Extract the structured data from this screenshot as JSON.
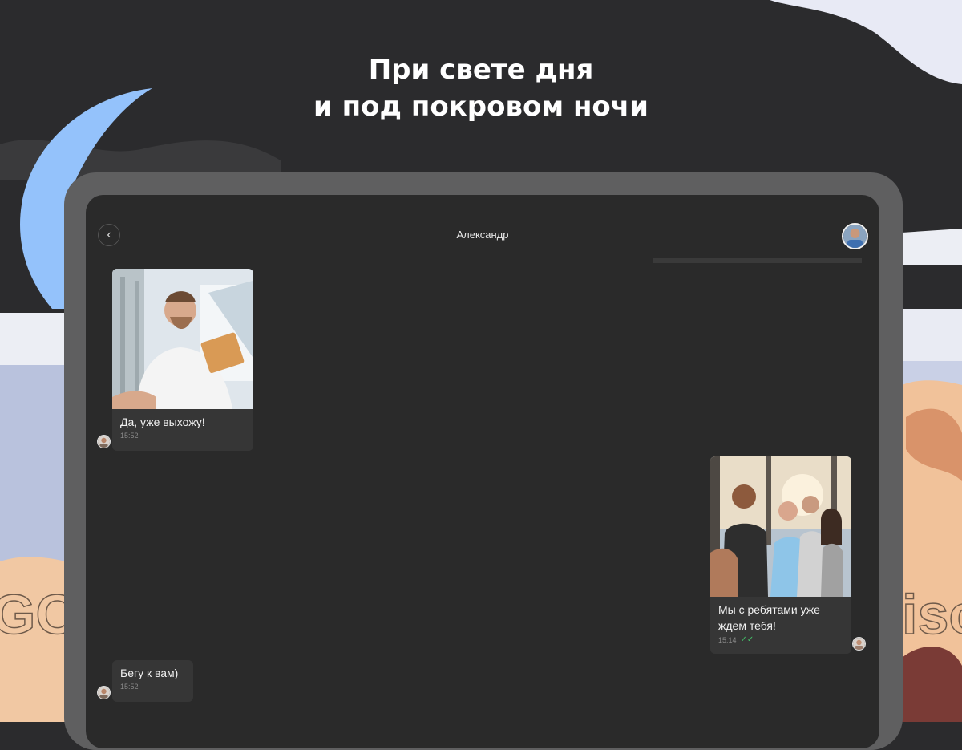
{
  "headline": {
    "line1": "При свете дня",
    "line2": "и под покровом ночи"
  },
  "chat": {
    "title": "Александр",
    "back_icon": "chevron-left-icon",
    "messages": [
      {
        "direction": "incoming",
        "has_photo": true,
        "text": "Да, уже выхожу!",
        "time": "15:52"
      },
      {
        "direction": "outgoing",
        "has_photo": true,
        "text": "Мы с ребятами уже ждем тебя!",
        "time": "15:14",
        "read_check": "double-check-icon"
      },
      {
        "direction": "incoming",
        "has_photo": false,
        "text": "Бегу к вам)",
        "time": "15:52"
      }
    ]
  },
  "colors": {
    "background": "#2b2b2d",
    "tablet_frame": "#5f5f60",
    "screen": "#2a2a2a",
    "bubble": "#363636",
    "moon": "#94c2fb",
    "read_check": "#43c068"
  }
}
